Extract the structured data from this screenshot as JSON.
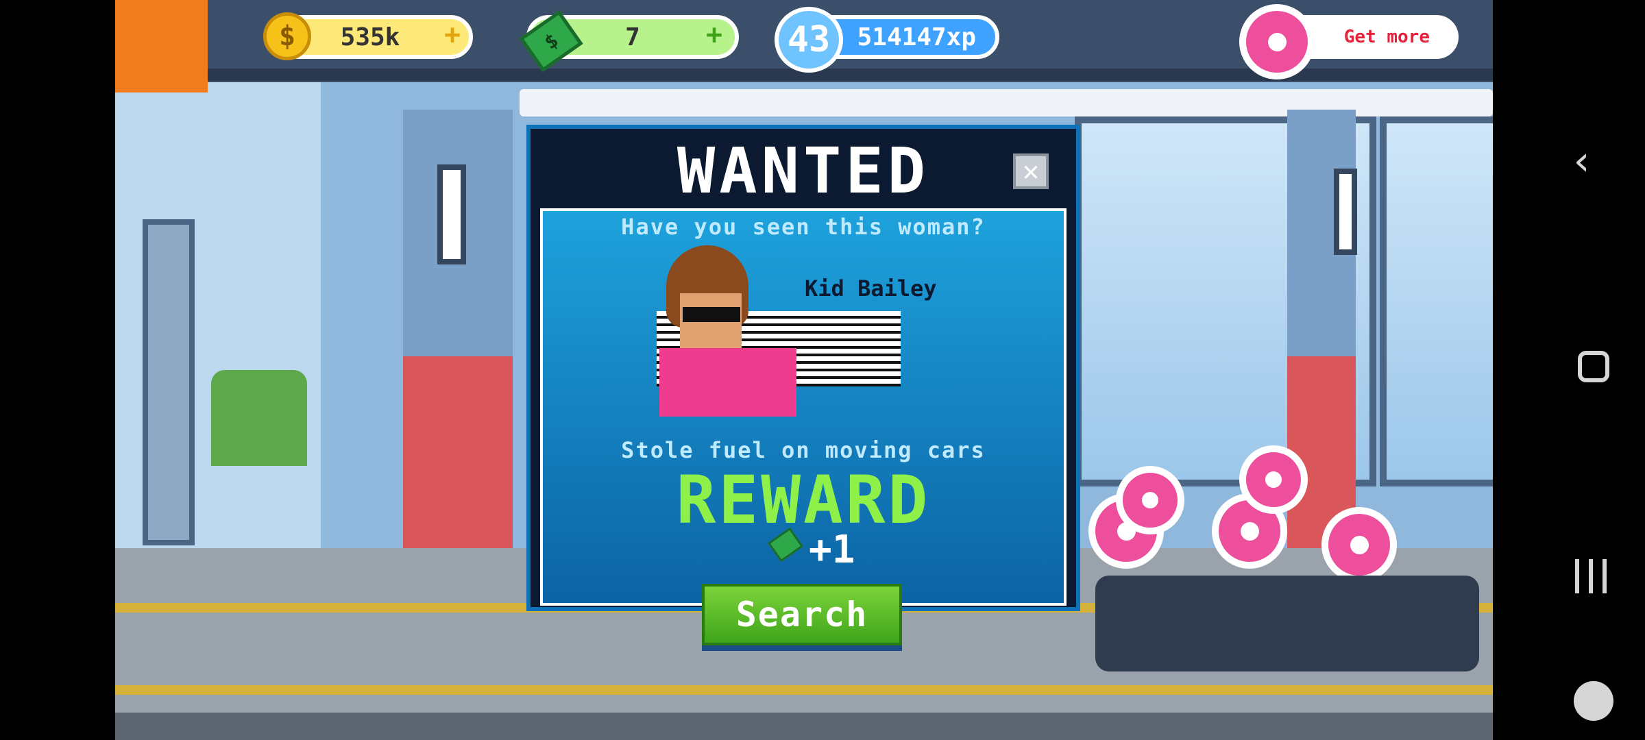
{
  "hud": {
    "coins": "535k",
    "cash": "7",
    "level": "43",
    "xp": "514147xp",
    "get_more": "Get more",
    "plus": "+"
  },
  "dialog": {
    "title": "WANTED",
    "close_glyph": "✕",
    "question": "Have you seen this woman?",
    "suspect_name": "Kid Bailey",
    "crime": "Stole fuel on moving cars",
    "reward_label": "REWARD",
    "reward_amount": "+1",
    "search_label": "Search"
  },
  "colors": {
    "reward_green": "#8ff04a",
    "dialog_blue": "#1ea2dc",
    "search_green": "#5cc22a",
    "donut_pink": "#ee4f9d"
  },
  "icons": [
    "coin-icon",
    "cash-icon",
    "level-badge-icon",
    "donut-icon",
    "close-icon",
    "back-icon",
    "home-icon",
    "recents-icon",
    "game-tools-icon"
  ]
}
